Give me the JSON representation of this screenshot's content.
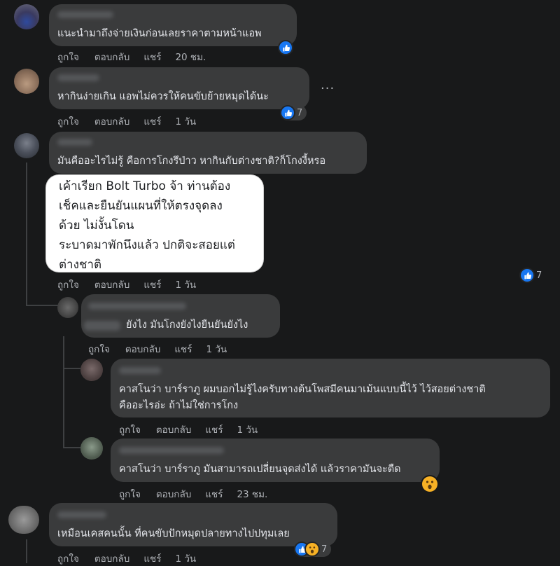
{
  "comments": [
    {
      "text": "แนะนำมาถึงจ่ายเงินก่อนเลยราคาตามหน้าแอพ",
      "time": "20 ชม.",
      "reactions": {
        "count": ""
      }
    },
    {
      "text": "หากินง่ายเกิน แอพไม่ควรให้คนขับย้ายหมุดได้นะ",
      "time": "1 วัน",
      "reactions": {
        "count": "7"
      }
    },
    {
      "text": "มันคืออะไรไม่รู้ คือการโกงรึป่าว หากินกับต่างชาติ?ก็โกงงี้หรอ",
      "time": "1 วัน",
      "reactions": {
        "count": ""
      }
    },
    {
      "quote_lines": [
        "เค้าเรียก Bolt Turbo จ้า ท่านต้อง",
        "เช็คและยืนยันแผนที่ให้ตรงจุดลง",
        "ด้วย ไม่งั้นโดน",
        "ระบาดมาพักนึงแล้ว ปกติจะสอยแต่",
        "ต่างชาติ"
      ],
      "time": "1 วัน",
      "reactions": {
        "count": "7"
      }
    },
    {
      "text": "ยังไง มันโกงยังไงยืนยันยังไง",
      "time": "1 วัน"
    },
    {
      "text_lines": [
        "คาสโนว่า บาร์ราภู ผมบอกไม่รู้ไงครับทางต้นโพสมีคนมาเม้นแบบนี้ไว้ ไว้สอยต่างชาติ",
        "คืออะไรอ่ะ ถ้าไม่ใช่การโกง"
      ],
      "time": "1 วัน"
    },
    {
      "text": "คาสโนว่า บาร์ราภู มันสามารถเปลี่ยนจุดส่งได้ แล้วราคามันจะตืด",
      "time": "23 ชม."
    },
    {
      "text": "เหมือนเคสคนนั้น ที่คนขับปักหมุดปลายทางไปปทุมเลย",
      "time": "1 วัน",
      "reactions": {
        "count": "7"
      }
    }
  ],
  "actions": {
    "like": "ถูกใจ",
    "reply": "ตอบกลับ",
    "share": "แชร์"
  },
  "more_options": "···",
  "colors": {
    "background": "#18191a",
    "bubble": "#3a3b3c",
    "text": "#e4e6eb",
    "meta": "#b0b3b8",
    "like": "#1877f2",
    "wow": "#f7b125"
  },
  "icons": {
    "like": "thumbs-up-icon",
    "wow": "wow-face-icon",
    "more": "more-dots-icon"
  }
}
